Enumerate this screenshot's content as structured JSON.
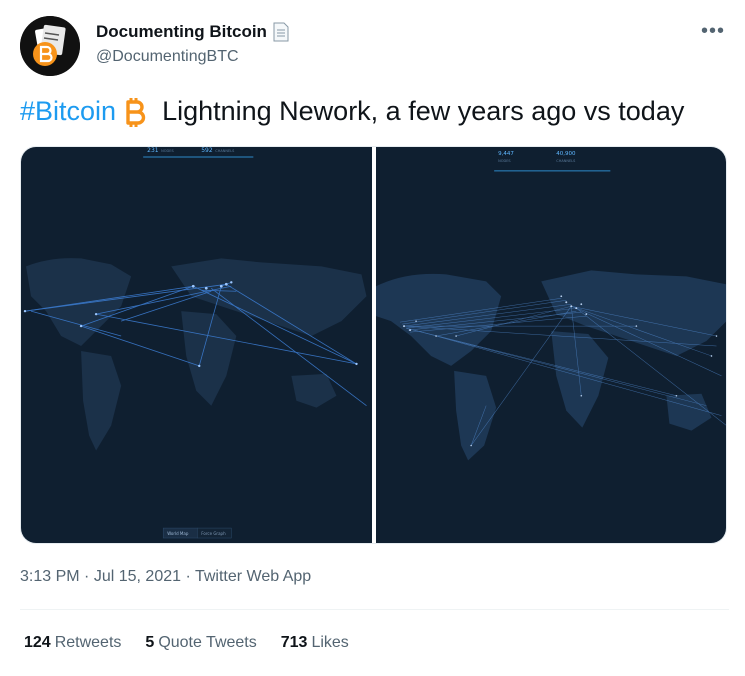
{
  "author": {
    "name": "Documenting Bitcoin",
    "handle": "@DocumentingBTC",
    "badge_icon": "document-icon"
  },
  "more_icon": "more-options-icon",
  "tweet": {
    "hashtag": "#Bitcoin",
    "btc_emoji": "bitcoin-icon",
    "text": "Lightning Nework, a few years ago vs today"
  },
  "media": {
    "left": {
      "nodes": "231",
      "nodes_label": "NODES",
      "channels": "592",
      "channels_label": "CHANNELS",
      "view_buttons": [
        "World Map",
        "Force Graph"
      ]
    },
    "right": {
      "nodes": "9,447",
      "nodes_label": "NODES",
      "channels": "40,900",
      "channels_label": "CHANNELS"
    }
  },
  "meta": {
    "time": "3:13 PM",
    "date": "Jul 15, 2021",
    "source": "Twitter Web App",
    "separator": "·"
  },
  "stats": {
    "retweets_count": "124",
    "retweets_label": "Retweets",
    "quotes_count": "5",
    "quotes_label": "Quote Tweets",
    "likes_count": "713",
    "likes_label": "Likes"
  },
  "colors": {
    "accent": "#1d9bf0",
    "bitcoin": "#f7931a",
    "map_bg": "#0f1f30",
    "land": "#1b3149",
    "link": "#3d7fd6"
  }
}
